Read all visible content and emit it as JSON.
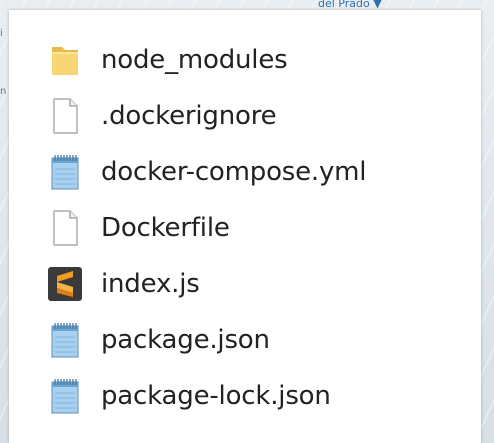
{
  "backdrop": {
    "top_text": "del Prado ▼",
    "left_text_1": "i",
    "left_text_2": "n"
  },
  "files": [
    {
      "name": "node_modules",
      "icon": "folder-icon"
    },
    {
      "name": ".dockerignore",
      "icon": "file-icon"
    },
    {
      "name": "docker-compose.yml",
      "icon": "notepad-icon"
    },
    {
      "name": "Dockerfile",
      "icon": "file-icon"
    },
    {
      "name": "index.js",
      "icon": "sublime-text-icon"
    },
    {
      "name": "package.json",
      "icon": "notepad-icon"
    },
    {
      "name": "package-lock.json",
      "icon": "notepad-icon"
    }
  ],
  "colors": {
    "folder": "#f3cf6a",
    "sublime_bg": "#3a3a3a",
    "sublime_accent": "#f29b22",
    "notepad": "#8fc1e6"
  }
}
